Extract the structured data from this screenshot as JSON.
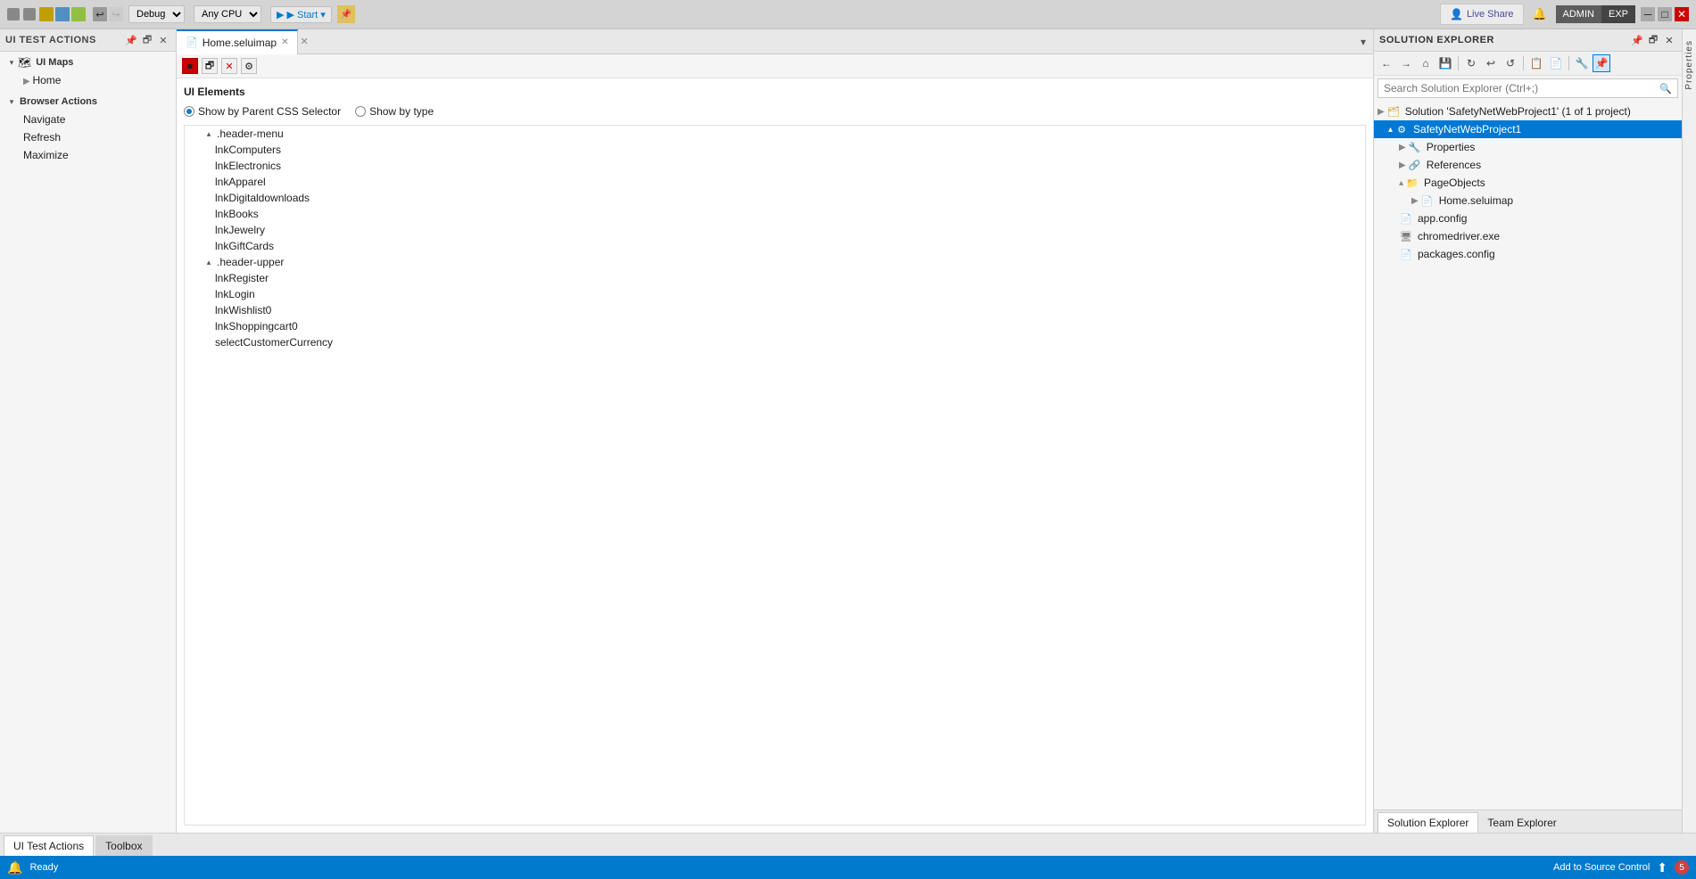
{
  "titlebar": {
    "undo_icon": "↩",
    "redo_icon": "↪",
    "debug_label": "Debug",
    "cpu_label": "Any CPU",
    "start_label": "▶ Start",
    "pin_icon": "📌",
    "live_share_label": "Live Share",
    "admin_label": "ADMIN",
    "exp_label": "EXP",
    "collapse_icon": "↕",
    "arrow_icon": "🔔"
  },
  "left_panel": {
    "title": "UI Test Actions",
    "pin_icon": "📌",
    "window_icon": "🗗",
    "close_icon": "✕",
    "sections": [
      {
        "name": "ui_maps",
        "label": "UI Maps",
        "toggle": "▾",
        "items": [
          "Home"
        ]
      },
      {
        "name": "browser_actions",
        "label": "Browser Actions",
        "toggle": "▾",
        "items": [
          "Navigate",
          "Refresh",
          "Maximize"
        ]
      }
    ]
  },
  "center_panel": {
    "tab_label": "Home.seluimap",
    "tab_icon": "📄",
    "close_icon": "✕",
    "pin_icon": "📌",
    "more_icon": "▾",
    "toolbar": {
      "stop_icon": "⏹",
      "window_icon": "🗗",
      "close_icon": "✕",
      "settings_icon": "⚙"
    },
    "section_title": "UI Elements",
    "radio_options": [
      {
        "id": "css",
        "label": "Show by Parent CSS Selector",
        "selected": true
      },
      {
        "id": "type",
        "label": "Show by type",
        "selected": false
      }
    ],
    "tree": [
      {
        "id": "header_menu",
        "label": ".header-menu",
        "expanded": true,
        "children": [
          "lnkComputers",
          "lnkElectronics",
          "lnkApparel",
          "lnkDigitaldownloads",
          "lnkBooks",
          "lnkJewelry",
          "lnkGiftCards"
        ]
      },
      {
        "id": "header_upper",
        "label": ".header-upper",
        "expanded": true,
        "children": [
          "lnkRegister",
          "lnkLogin",
          "lnkWishlist0",
          "lnkShoppingcart0",
          "selectCustomerCurrency"
        ]
      }
    ]
  },
  "solution_explorer": {
    "title": "Solution Explorer",
    "icons": {
      "back": "←",
      "forward": "→",
      "home": "⌂",
      "save": "💾",
      "refresh_group": "↻",
      "undo": "↩",
      "refresh": "↺",
      "copy": "📋",
      "paste": "📄",
      "properties": "🔧",
      "pin": "📌"
    },
    "search_placeholder": "Search Solution Explorer (Ctrl+;)",
    "search_icon": "🔍",
    "tree": {
      "solution_label": "Solution 'SafetyNetWebProject1' (1 of 1 project)",
      "project_label": "SafetyNetWebProject1",
      "properties_label": "Properties",
      "references_label": "References",
      "page_objects_label": "PageObjects",
      "home_seluimap_label": "Home.seluimap",
      "app_config_label": "app.config",
      "chromedriver_label": "chromedriver.exe",
      "packages_label": "packages.config"
    }
  },
  "properties_sidebar": {
    "label": "Properties"
  },
  "bottom": {
    "tabs": [
      {
        "label": "UI Test Actions",
        "active": true
      },
      {
        "label": "Toolbox",
        "active": false
      }
    ],
    "solution_explorer_tab": "Solution Explorer",
    "team_explorer_tab": "Team Explorer"
  },
  "status_bar": {
    "left_icon": "🔔",
    "ready_label": "Ready",
    "right_label": "Add to Source Control",
    "git_icon": "⬆",
    "notification": "5"
  }
}
